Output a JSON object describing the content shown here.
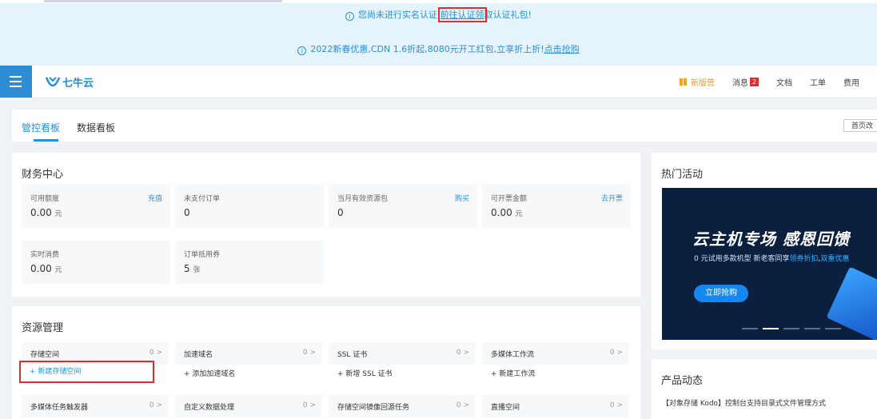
{
  "banner": {
    "verify_prefix": "您尚未进行实名认证,",
    "verify_link": "前往认证领",
    "verify_suffix": "取认证礼包!",
    "promo_text": "2022新春优惠,CDN 1.6折起,8080元开工红包,立享折上折!",
    "promo_link": "点击抢购"
  },
  "navbar": {
    "logo_text": "七牛云",
    "items": [
      "新版营",
      "消息",
      "文档",
      "工单",
      "费用"
    ],
    "message_count": "2"
  },
  "tabs": {
    "items": [
      "管控看板",
      "数据看板"
    ],
    "right_button": "首页改"
  },
  "finance": {
    "title": "财务中心",
    "cells": [
      {
        "label": "可用额度",
        "action": "充值",
        "value": "0.00",
        "unit": "元"
      },
      {
        "label": "未支付订单",
        "action": "",
        "value": "0",
        "unit": ""
      },
      {
        "label": "当月有效资源包",
        "action": "购买",
        "value": "0",
        "unit": ""
      },
      {
        "label": "可开票金额",
        "action": "去开票",
        "value": "0.00",
        "unit": "元"
      },
      {
        "label": "实时消费",
        "action": "",
        "value": "0.00",
        "unit": "元"
      },
      {
        "label": "订单抵用券",
        "action": "",
        "value": "5",
        "unit": "张"
      }
    ]
  },
  "resources": {
    "title": "资源管理",
    "rows": [
      {
        "label": "存储空间",
        "count": "0 >",
        "add": "+ 新建存储空间"
      },
      {
        "label": "加速域名",
        "count": "0 >",
        "add": "+ 添加加速域名"
      },
      {
        "label": "SSL 证书",
        "count": "0 >",
        "add": "+ 新增 SSL 证书"
      },
      {
        "label": "多媒体工作流",
        "count": "0 >",
        "add": "+ 新建工作流"
      }
    ],
    "row2": [
      {
        "label": "多媒体任务触发器",
        "count": "0 >"
      },
      {
        "label": "自定义数据处理",
        "count": "0 >"
      },
      {
        "label": "存储空间镜像回源任务",
        "count": "0 >"
      },
      {
        "label": "直播空间",
        "count": "0 >"
      }
    ]
  },
  "activities": {
    "title": "热门活动",
    "promo_title": "云主机专场 感恩回馈",
    "promo_sub_prefix": "0 元试用多款机型 新老客同享",
    "promo_sub_highlight1": "领券折扣",
    "promo_sub_highlight2": "双重优惠",
    "promo_cta": "立即抢购"
  },
  "news": {
    "title": "产品动态",
    "items": [
      "【对象存储 Kodo】控制台支持目录式文件管理方式"
    ]
  }
}
